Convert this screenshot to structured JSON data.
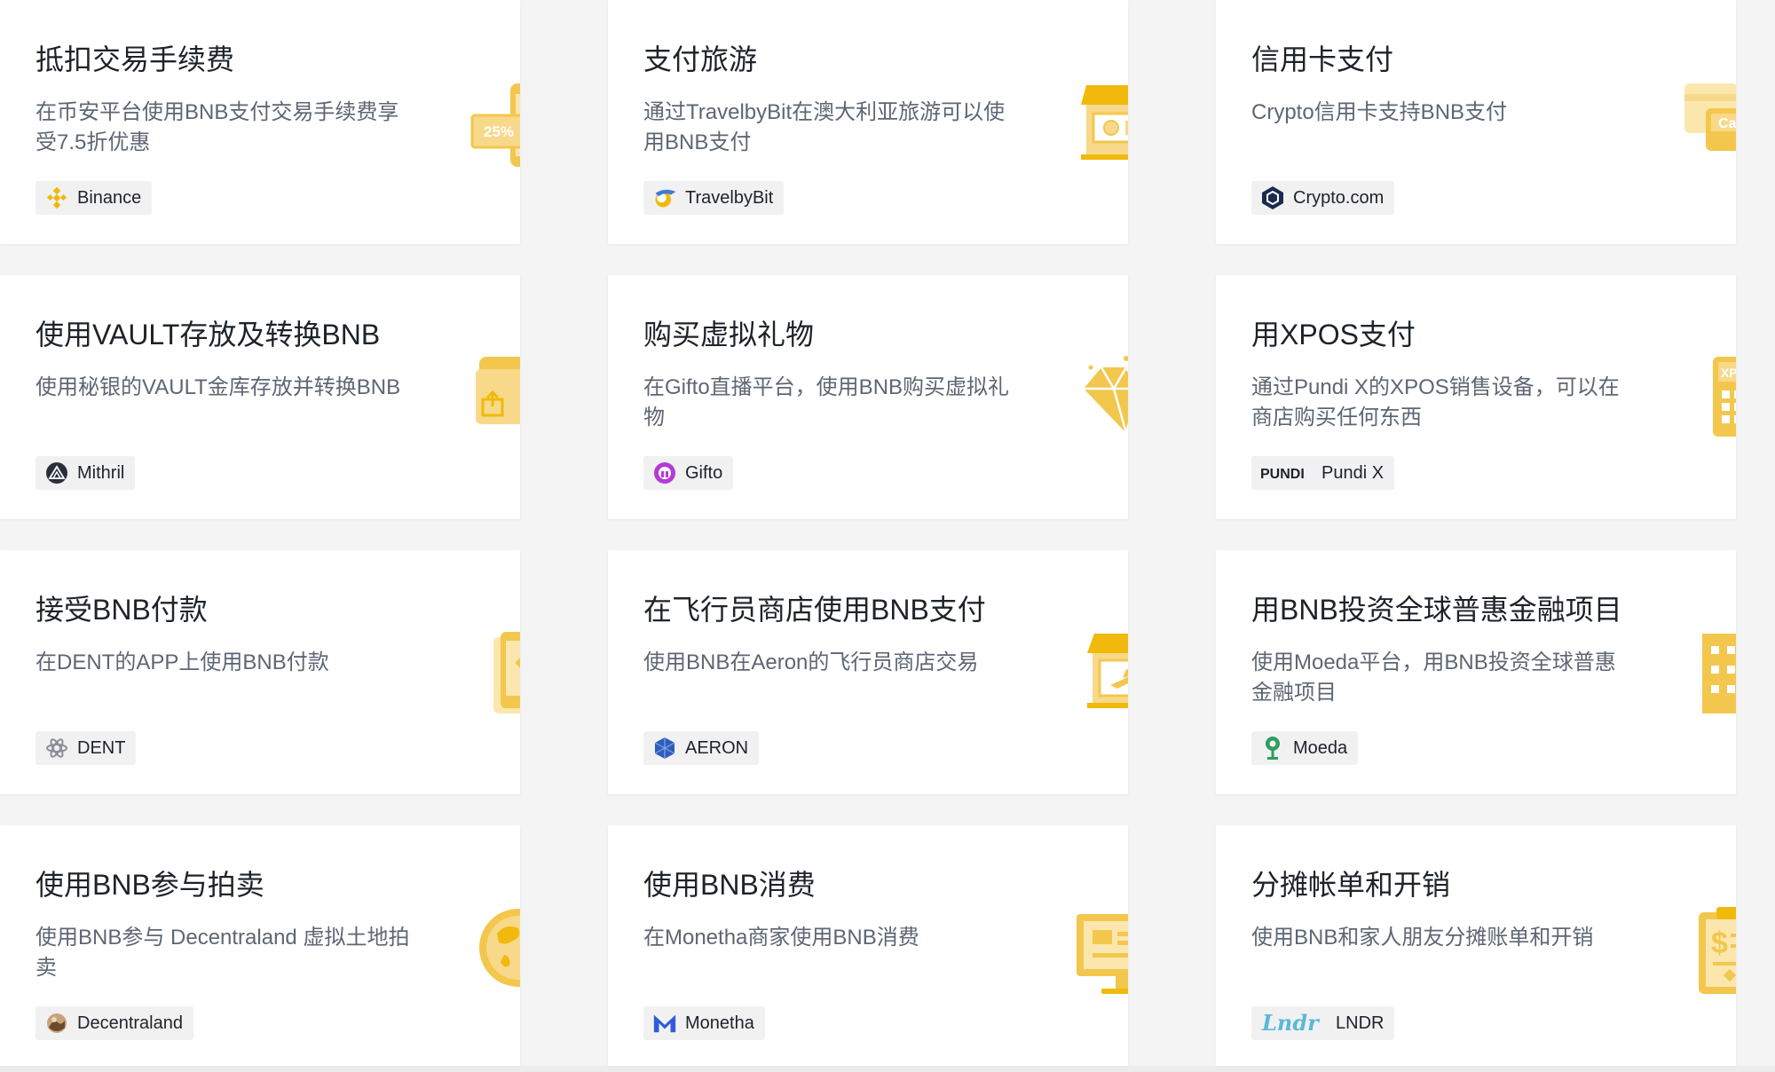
{
  "colors": {
    "gold": "#F0B90B",
    "gold_light": "#F8D98A",
    "gold_mid": "#F3C74D",
    "card_bg": "#FFFFFF",
    "page_bg": "#F4F4F4",
    "title": "#1E2329",
    "desc": "#5E6673"
  },
  "cards": [
    {
      "title": "抵扣交易手续费",
      "desc": "在币安平台使用BNB支付交易手续费享受7.5折优惠",
      "partner": "Binance",
      "partner_icon": "binance-logo-icon",
      "illustration": "phone-discount-icon",
      "illus_text": "25%"
    },
    {
      "title": "支付旅游",
      "desc": "通过TravelbyBit在澳大利亚旅游可以使用BNB支付",
      "partner": "TravelbyBit",
      "partner_icon": "travelbybit-logo-icon",
      "illustration": "shop-cash-icon"
    },
    {
      "title": "信用卡支付",
      "desc": "Crypto信用卡支持BNB支付",
      "partner": "Crypto.com",
      "partner_icon": "crypto-com-logo-icon",
      "illustration": "credit-card-icon",
      "illus_text": "Card"
    },
    {
      "title": "使用VAULT存放及转换BNB",
      "desc": "使用秘银的VAULT金库存放并转换BNB",
      "partner": "Mithril",
      "partner_icon": "mithril-logo-icon",
      "illustration": "wallet-icon"
    },
    {
      "title": "购买虚拟礼物",
      "desc": "在Gifto直播平台，使用BNB购买虚拟礼物",
      "partner": "Gifto",
      "partner_icon": "gifto-logo-icon",
      "illustration": "diamond-icon"
    },
    {
      "title": "用XPOS支付",
      "desc": "通过Pundi X的XPOS销售设备，可以在商店购买任何东西",
      "partner": "Pundi X",
      "partner_icon": "pundi-x-logo-icon",
      "partner_logo_text": "PUNDI",
      "illustration": "pos-terminal-icon",
      "illus_text": "XPOS"
    },
    {
      "title": "接受BNB付款",
      "desc": "在DENT的APP上使用BNB付款",
      "partner": "DENT",
      "partner_icon": "dent-logo-icon",
      "illustration": "phone-bnb-icon"
    },
    {
      "title": "在飞行员商店使用BNB支付",
      "desc": "使用BNB在Aeron的飞行员商店交易",
      "partner": "AERON",
      "partner_icon": "aeron-logo-icon",
      "illustration": "airplane-shop-icon"
    },
    {
      "title": "用BNB投资全球普惠金融项目",
      "desc": "使用Moeda平台，用BNB投资全球普惠金融项目",
      "partner": "Moeda",
      "partner_icon": "moeda-logo-icon",
      "illustration": "building-icon"
    },
    {
      "title": "使用BNB参与拍卖",
      "desc": "使用BNB参与 Decentraland 虚拟土地拍卖",
      "partner": "Decentraland",
      "partner_icon": "decentraland-logo-icon",
      "illustration": "globe-auction-icon"
    },
    {
      "title": "使用BNB消费",
      "desc": "在Monetha商家使用BNB消费",
      "partner": "Monetha",
      "partner_icon": "monetha-logo-icon",
      "illustration": "monitor-icon"
    },
    {
      "title": "分摊帐单和开销",
      "desc": "使用BNB和家人朋友分摊账单和开销",
      "partner": "LNDR",
      "partner_icon": "lndr-logo-icon",
      "partner_logo_text": "Lndr",
      "illustration": "bill-clipboard-icon"
    }
  ]
}
